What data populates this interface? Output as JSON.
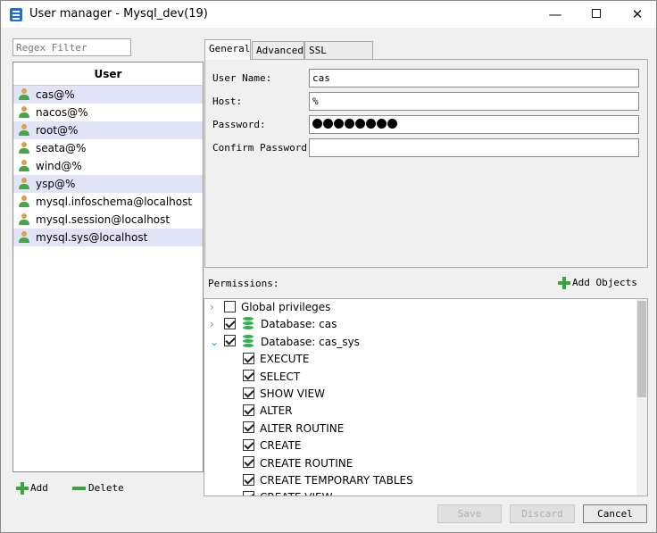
{
  "window": {
    "title": "User manager - Mysql_dev(19)",
    "controls": {
      "minimize": "—",
      "maximize": "",
      "close": "✕"
    }
  },
  "filter": {
    "placeholder": "Regex Filter"
  },
  "user_list": {
    "header": "User",
    "items": [
      "cas@%",
      "nacos@%",
      "root@%",
      "seata@%",
      "wind@%",
      "ysp@%",
      "mysql.infoschema@localhost",
      "mysql.session@localhost",
      "mysql.sys@localhost"
    ]
  },
  "user_actions": {
    "add": "Add",
    "delete": "Delete"
  },
  "tabs": [
    {
      "label": "General",
      "active": true
    },
    {
      "label": "Advanced",
      "active": false
    },
    {
      "label": "SSL Options",
      "active": false
    }
  ],
  "general": {
    "user_name_label": "User Name:",
    "user_name_value": "cas",
    "host_label": "Host:",
    "host_value": "%",
    "password_label": "Password:",
    "password_dot_count": 8,
    "confirm_password_label": "Confirm Password:",
    "confirm_password_value": ""
  },
  "permissions": {
    "label": "Permissions:",
    "add_objects": "Add Objects",
    "tree": [
      {
        "label": "Global privileges",
        "expand": "collapsed",
        "checked": false
      },
      {
        "label": "Database: cas",
        "expand": "collapsed",
        "checked": true,
        "db": true
      },
      {
        "label": "Database: cas_sys",
        "expand": "expanded",
        "checked": true,
        "db": true
      },
      {
        "label": "EXECUTE",
        "checked": true
      },
      {
        "label": "SELECT",
        "checked": true
      },
      {
        "label": "SHOW VIEW",
        "checked": true
      },
      {
        "label": "ALTER",
        "checked": true
      },
      {
        "label": "ALTER ROUTINE",
        "checked": true
      },
      {
        "label": "CREATE",
        "checked": true
      },
      {
        "label": "CREATE ROUTINE",
        "checked": true
      },
      {
        "label": "CREATE TEMPORARY TABLES",
        "checked": true
      },
      {
        "label": "CREATE VIEW",
        "checked": true
      }
    ]
  },
  "footer": {
    "save": "Save",
    "discard": "Discard",
    "cancel": "Cancel"
  },
  "colors": {
    "selected_row": "#e1e4f7",
    "accent_green": "#3aa53a",
    "db_icon": "#2fb24c"
  }
}
